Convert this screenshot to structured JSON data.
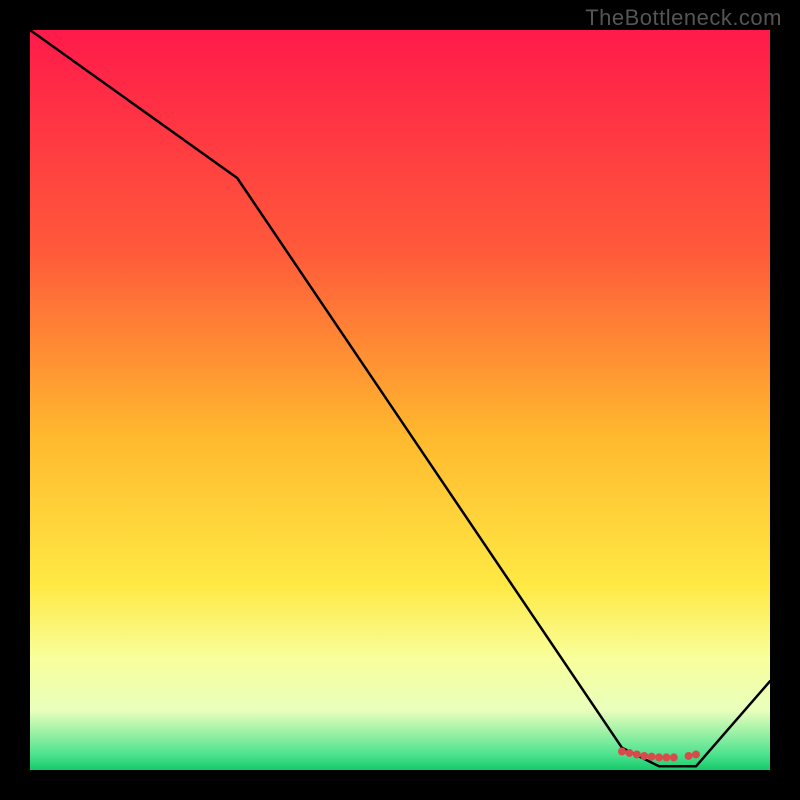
{
  "watermark": "TheBottleneck.com",
  "chart_data": {
    "type": "line",
    "title": "",
    "xlabel": "",
    "ylabel": "",
    "xlim": [
      0,
      100
    ],
    "ylim": [
      0,
      100
    ],
    "series": [
      {
        "name": "curve",
        "x": [
          0,
          28,
          80,
          85,
          90,
          100
        ],
        "y": [
          100,
          80,
          3,
          0.5,
          0.5,
          12
        ]
      }
    ],
    "markers": {
      "x": [
        80,
        81,
        82,
        83,
        84,
        85,
        86,
        87,
        89,
        90
      ],
      "y": [
        2.5,
        2.3,
        2.1,
        1.9,
        1.8,
        1.7,
        1.7,
        1.7,
        1.9,
        2.1
      ],
      "color": "#d84b4b"
    },
    "background_gradient": {
      "stops": [
        {
          "offset": 0,
          "color": "#ff1a4a"
        },
        {
          "offset": 30,
          "color": "#ff5a3a"
        },
        {
          "offset": 55,
          "color": "#ffb92e"
        },
        {
          "offset": 75,
          "color": "#ffe944"
        },
        {
          "offset": 85,
          "color": "#f8ff9c"
        },
        {
          "offset": 92,
          "color": "#e8ffbc"
        },
        {
          "offset": 98,
          "color": "#4be28e"
        },
        {
          "offset": 100,
          "color": "#16c96a"
        }
      ]
    }
  }
}
